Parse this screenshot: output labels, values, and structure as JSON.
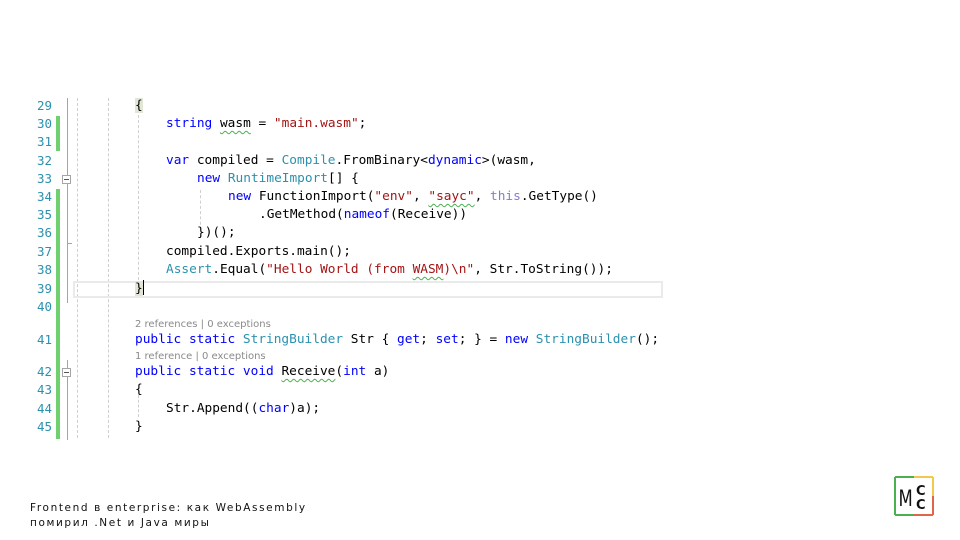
{
  "editor": {
    "line_numbers": [
      "29",
      "30",
      "31",
      "32",
      "33",
      "34",
      "35",
      "36",
      "37",
      "38",
      "39",
      "40",
      "41",
      "42",
      "43",
      "44",
      "45"
    ],
    "changed_lines": [
      "30",
      "31",
      "34",
      "35",
      "36",
      "37",
      "38",
      "39",
      "40",
      "41",
      "42",
      "43",
      "44",
      "45"
    ],
    "current_line": "39",
    "codelens": [
      {
        "before_line": "41",
        "text": "2 references | 0 exceptions"
      },
      {
        "before_line": "42",
        "text": "1 reference | 0 exceptions"
      }
    ],
    "code": {
      "l29": {
        "brace": "{"
      },
      "l30": {
        "kw": "string",
        "var": "wasm",
        "eq": " = ",
        "str": "\"main.wasm\"",
        "end": ";"
      },
      "l32": {
        "kw": "var",
        "rest": " compiled = ",
        "ty": "Compile",
        "call": ".FromBinary<",
        "kw2": "dynamic",
        "end": ">(wasm,"
      },
      "l33": {
        "kw": "new",
        "sp": " ",
        "ty": "RuntimeImport",
        "end": "[] {"
      },
      "l34": {
        "kw": "new",
        "rest": " FunctionImport(",
        "s1": "\"env\"",
        "comma": ", ",
        "s2": "\"sayc\"",
        "comma2": ", ",
        "kw2": "this",
        "end": ".GetType()"
      },
      "l35": {
        "call": ".GetMethod(",
        "kw": "nameof",
        "end": "(Receive))"
      },
      "l36": {
        "text": "})();"
      },
      "l37": {
        "text": "compiled.Exports.main();"
      },
      "l38": {
        "ty": "Assert",
        "call": ".Equal(",
        "str1": "\"Hello World (from ",
        "str_sq": "WASM",
        "str2": ")\\n\"",
        "end": ", Str.ToString());"
      },
      "l39": {
        "brace": "}"
      },
      "l41": {
        "kw1": "public",
        "kw2": "static",
        "ty": "StringBuilder",
        "mid": " Str { ",
        "kw3": "get",
        "semi1": "; ",
        "kw4": "set",
        "semi2": "; } = ",
        "kw5": "new",
        "ty2": "StringBuilder",
        "end": "();"
      },
      "l42": {
        "kw1": "public",
        "kw2": "static",
        "kw3": "void",
        "name": "Receive",
        "open": "(",
        "kw4": "int",
        "end": " a)"
      },
      "l43": {
        "brace": "{"
      },
      "l44": {
        "pre": "Str.Append((",
        "kw": "char",
        "end": ")a);"
      },
      "l45": {
        "brace": "}"
      }
    }
  },
  "footer": {
    "line1": "Frontend в enterprise: как WebAssembly",
    "line2": "помирил .Net и Java миры"
  },
  "logo": {
    "letters": [
      "M",
      "C",
      "C"
    ],
    "colors": {
      "green": "#4caf50",
      "yellow": "#f2c94c",
      "red": "#e0664a"
    }
  }
}
